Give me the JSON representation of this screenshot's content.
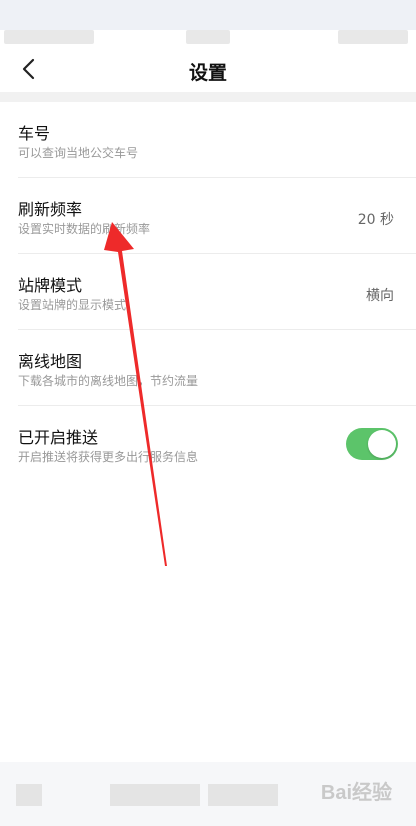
{
  "nav": {
    "title": "设置"
  },
  "settings": [
    {
      "label": "车号",
      "desc": "可以查询当地公交车号",
      "value": ""
    },
    {
      "label": "刷新频率",
      "desc": "设置实时数据的刷新频率",
      "value": "20 秒"
    },
    {
      "label": "站牌模式",
      "desc": "设置站牌的显示模式",
      "value": "横向"
    },
    {
      "label": "离线地图",
      "desc": "下载各城市的离线地图，节约流量",
      "value": ""
    },
    {
      "label": "已开启推送",
      "desc": "开启推送将获得更多出行服务信息",
      "toggle_on": true
    }
  ],
  "colors": {
    "toggle_on": "#5cc46a",
    "annotation_arrow": "#ee2a2a"
  },
  "watermark": "Bai经验"
}
